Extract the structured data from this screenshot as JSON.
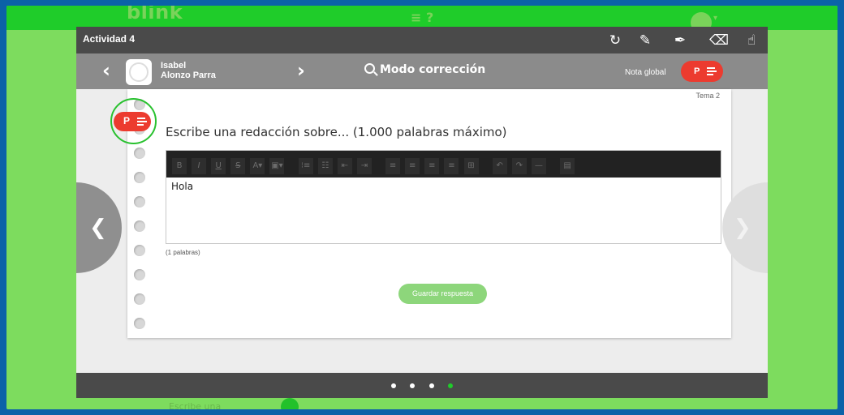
{
  "app": {
    "logo": "blink",
    "menu_icon": "menu-icon",
    "help_icon": "help-icon"
  },
  "background": {
    "text": "Escribe una"
  },
  "modal": {
    "title": "Actividad 4",
    "tools": [
      "refresh-icon",
      "pencil-icon",
      "marker-icon",
      "eraser-icon",
      "hand-icon"
    ]
  },
  "student": {
    "first_name": "Isabel",
    "last_name": "Alonzo Parra"
  },
  "mode": {
    "label": "Modo corrección"
  },
  "grade": {
    "label": "Nota global",
    "value": "P"
  },
  "content": {
    "topic": "Tema 2",
    "question": "Escribe una redacción sobre... (1.000 palabras máximo)",
    "answer": "Hola",
    "word_count": "(1 palabras)",
    "save_label": "Guardar respuesta",
    "mark_value": "P"
  },
  "toolbar": {
    "bold": "B",
    "italic": "I",
    "underline": "U",
    "strike": "S",
    "color": "A▾",
    "bg": "▣▾",
    "ol": "⁝≡",
    "ul": "☷",
    "outdent": "⇤",
    "indent": "⇥",
    "left": "≡",
    "center": "≡",
    "right": "≡",
    "justify": "≡",
    "table": "⊞",
    "undo": "↶",
    "redo": "↷",
    "hr": "—",
    "doc": "▤"
  },
  "pagination": {
    "total": 4,
    "active": 4
  },
  "colors": {
    "accent": "#1fcc2a",
    "badge": "#ec3b2f",
    "header": "#4a4a4a",
    "button": "#8dd67b"
  }
}
